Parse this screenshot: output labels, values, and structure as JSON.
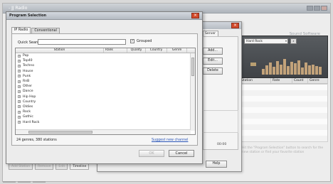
{
  "app": {
    "title": "- JJ Radio",
    "brand": "Sound Software"
  },
  "player": {
    "station": "Hard Rock",
    "eq_levels": [
      0.35,
      0.55,
      0.7,
      0.45,
      0.8,
      0.6,
      0.9,
      0.5,
      0.75,
      0.65,
      0.85,
      0.4,
      0.7,
      0.55,
      0.6,
      0.5,
      0.45
    ]
  },
  "stations_list": {
    "columns": [
      "Station",
      "Rate",
      "Count",
      "Genre"
    ]
  },
  "hint_text": "Hit the \"Program Selection\" button to search for the new station or find your favorite station",
  "bottom_buttons": [
    "Add Station",
    "Remove",
    "Edit",
    "Timeline"
  ],
  "middle_dialog": {
    "tab": "Server",
    "buttons": [
      "Add...",
      "Edit...",
      "Delete"
    ],
    "value": "00:00",
    "help": "Help"
  },
  "dialog": {
    "title": "Program Selection",
    "tabs": [
      "IP Radio",
      "Conventional"
    ],
    "quick_search_label": "Quick Search",
    "quick_search_value": "",
    "grouped_label": "Grouped",
    "grouped_checked": true,
    "columns": [
      "Station",
      "Rank",
      "Quality",
      "Country",
      "Genre"
    ],
    "genres": [
      "Pop",
      "Top40",
      "Techno",
      "House",
      "Punk",
      "RnB",
      "Other",
      "Dance",
      "Hip Hop",
      "Country",
      "Oldies",
      "Rock",
      "Gothic",
      "Hard Rock"
    ],
    "status": "24 genres, 380 stations",
    "suggest_link": "Suggest new channel",
    "ok_label": "OK",
    "cancel_label": "Cancel"
  }
}
